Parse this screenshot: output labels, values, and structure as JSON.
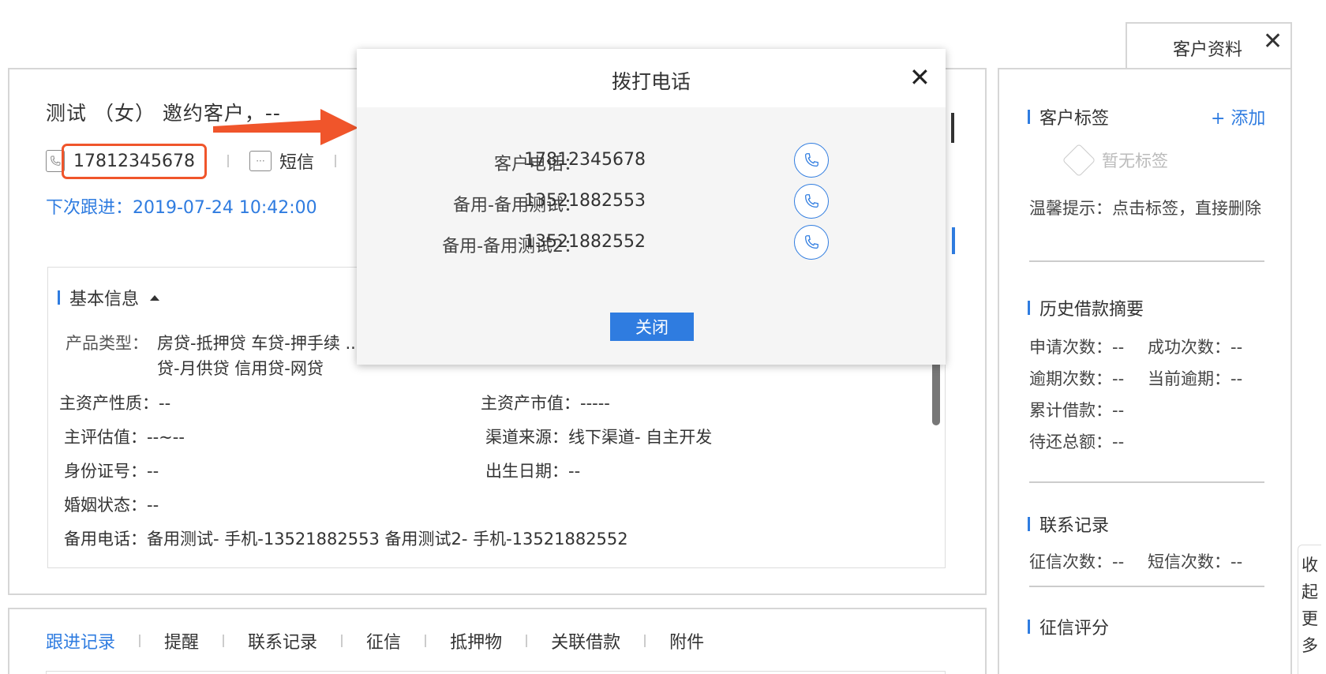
{
  "customer": {
    "title": "测试 （女） 邀约客户，--",
    "phone": "17812345678",
    "sms_label": "短信",
    "sms_icon_glyph": "···",
    "next_follow": "下次跟进：2019-07-24 10:42:00"
  },
  "basic_info": {
    "section_title": "基本信息",
    "product_type_label": "产品类型：",
    "product_type_value": "房贷-抵押贷 车贷-押手续 ... 值贷 信用贷-月供贷 信用贷-网贷",
    "asset_nature": "主资产性质：--",
    "asset_value": "主资产市值：-----",
    "main_valuation": "主评估值：--~--",
    "channel_source": "渠道来源：线下渠道- 自主开发",
    "id_number": "身份证号：--",
    "birth_date": "出生日期：--",
    "marital_status": "婚姻状态：--",
    "backup_phone": "备用电话：备用测试- 手机-13521882553 备用测试2- 手机-13521882552"
  },
  "tabs": [
    "跟进记录",
    "提醒",
    "联系记录",
    "征信",
    "抵押物",
    "关联借款",
    "附件"
  ],
  "sidebar": {
    "tab_label": "客户资料",
    "close_glyph": "✕",
    "tags_title": "客户标签",
    "add_label": "+ 添加",
    "no_tag": "暂无标签",
    "tip": "温馨提示：点击标签，直接删除",
    "history_title": "历史借款摘要",
    "apply_count": "申请次数：--",
    "success_count": "成功次数：--",
    "overdue_count": "逾期次数：--",
    "current_overdue": "当前逾期：--",
    "total_borrow": "累计借款：--",
    "pending_total": "待还总额：--",
    "contact_title": "联系记录",
    "credit_count": "征信次数：--",
    "sms_count": "短信次数：--",
    "credit_score_title": "征信评分",
    "collapse_more": "收起更多"
  },
  "dialog": {
    "title": "拨打电话",
    "close_glyph": "✕",
    "rows": [
      {
        "label": "客户电话：",
        "value": "17812345678"
      },
      {
        "label": "备用-备用测试：",
        "value": "13521882553"
      },
      {
        "label": "备用-备用测试2：",
        "value": "13521882552"
      }
    ],
    "close_button": "关闭"
  },
  "colors": {
    "accent": "#2f7ce0",
    "highlight": "#f0552b"
  }
}
